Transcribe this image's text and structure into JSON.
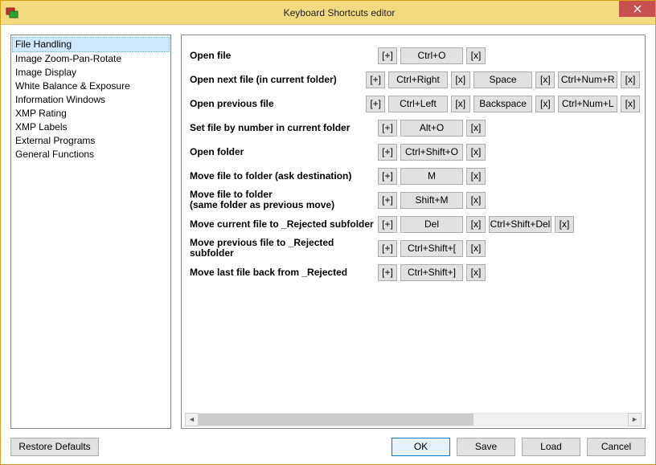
{
  "window": {
    "title": "Keyboard Shortcuts editor"
  },
  "sidebar": {
    "items": [
      "File Handling",
      "Image Zoom-Pan-Rotate",
      "Image Display",
      "White Balance & Exposure",
      "Information Windows",
      "XMP Rating",
      "XMP Labels",
      "External Programs",
      "General Functions"
    ],
    "selected_index": 0
  },
  "glyph": {
    "plus": "[+]",
    "x": "[x]"
  },
  "shortcuts": [
    {
      "label": "Open file",
      "twoline": false,
      "bindings": [
        "Ctrl+O"
      ]
    },
    {
      "label": "Open next file (in current folder)",
      "twoline": false,
      "bindings": [
        "Ctrl+Right",
        "Space",
        "Ctrl+Num+R"
      ]
    },
    {
      "label": "Open previous file",
      "twoline": false,
      "bindings": [
        "Ctrl+Left",
        "Backspace",
        "Ctrl+Num+L"
      ]
    },
    {
      "label": "Set file by number in current folder",
      "twoline": false,
      "bindings": [
        "Alt+O"
      ]
    },
    {
      "label": "Open folder",
      "twoline": false,
      "bindings": [
        "Ctrl+Shift+O"
      ]
    },
    {
      "label": "Move file to folder (ask destination)",
      "twoline": false,
      "bindings": [
        "M"
      ]
    },
    {
      "label": "Move file to folder\n(same folder as previous move)",
      "twoline": true,
      "bindings": [
        "Shift+M"
      ]
    },
    {
      "label": "Move current file to _Rejected subfolder",
      "twoline": false,
      "bindings": [
        "Del",
        "Ctrl+Shift+Del"
      ]
    },
    {
      "label": "Move previous file to _Rejected subfolder",
      "twoline": false,
      "bindings": [
        "Ctrl+Shift+["
      ]
    },
    {
      "label": "Move last file back from _Rejected",
      "twoline": false,
      "bindings": [
        "Ctrl+Shift+]"
      ]
    }
  ],
  "footer": {
    "restore": "Restore Defaults",
    "ok": "OK",
    "save": "Save",
    "load": "Load",
    "cancel": "Cancel"
  }
}
